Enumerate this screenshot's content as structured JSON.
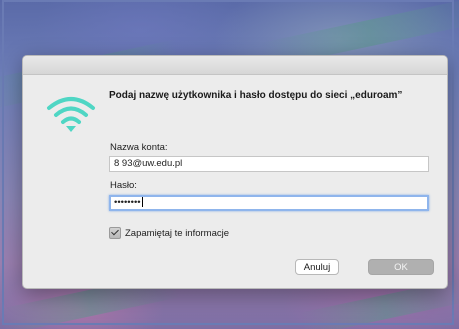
{
  "dialog": {
    "heading": "Podaj nazwę użytkownika i hasło dostępu do sieci „eduroam”",
    "account_label": "Nazwa konta:",
    "account_value": "8          93@uw.edu.pl",
    "password_label": "Hasło:",
    "password_value": "••••••••",
    "remember_label": "Zapamiętaj te informacje",
    "remember_checked": true,
    "cancel_label": "Anuluj",
    "ok_label": "OK"
  },
  "icons": {
    "wifi": "wifi-icon",
    "checkbox": "checkmark-icon"
  },
  "colors": {
    "wifi_accent": "#4fd6c4",
    "focus_ring": "#8fb5ec",
    "ok_button": "#b0b0b0"
  }
}
